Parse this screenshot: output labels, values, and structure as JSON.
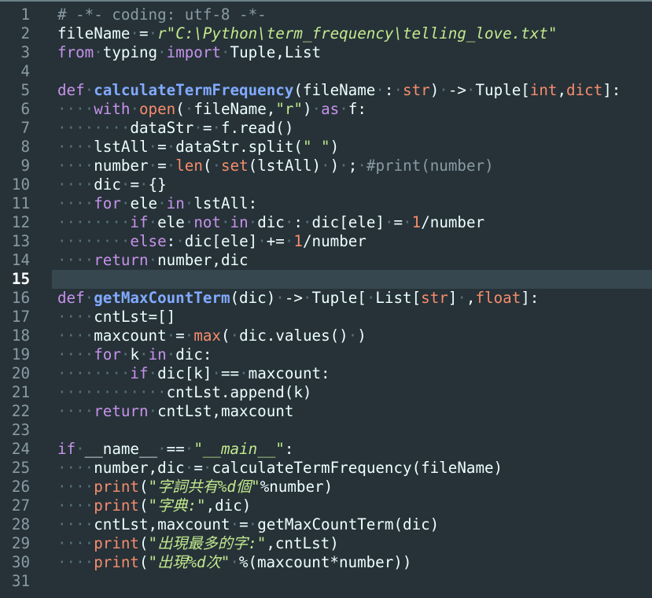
{
  "editor": {
    "language": "python",
    "current_line": 15,
    "line_numbers": [
      "1",
      "2",
      "3",
      "4",
      "5",
      "6",
      "7",
      "8",
      "9",
      "10",
      "11",
      "12",
      "13",
      "14",
      "15",
      "16",
      "17",
      "18",
      "19",
      "20",
      "21",
      "22",
      "23",
      "24",
      "25",
      "26",
      "27",
      "28",
      "29",
      "30",
      "31"
    ],
    "lines": [
      [
        {
          "t": "# -*- coding: utf-8 -*-",
          "c": "cmt"
        }
      ],
      [
        {
          "t": "fileName = "
        },
        {
          "t": "r\"C:\\Python\\term_frequency\\telling_love.txt\"",
          "c": "strit"
        }
      ],
      [
        {
          "t": "from",
          "c": "kw"
        },
        {
          "t": " typing "
        },
        {
          "t": "import",
          "c": "kw"
        },
        {
          "t": " Tuple,List"
        }
      ],
      [],
      [
        {
          "t": "def",
          "c": "kw"
        },
        {
          "t": " "
        },
        {
          "t": "calculateTermFrequency",
          "c": "fn"
        },
        {
          "t": "(fileName : "
        },
        {
          "t": "str",
          "c": "tp"
        },
        {
          "t": ") -> Tuple["
        },
        {
          "t": "int",
          "c": "tp"
        },
        {
          "t": ","
        },
        {
          "t": "dict",
          "c": "tp"
        },
        {
          "t": "]:"
        }
      ],
      [
        {
          "t": "    "
        },
        {
          "t": "with",
          "c": "kw"
        },
        {
          "t": " "
        },
        {
          "t": "open",
          "c": "bi"
        },
        {
          "t": "( fileName,"
        },
        {
          "t": "\"r\"",
          "c": "str"
        },
        {
          "t": ") "
        },
        {
          "t": "as",
          "c": "kw"
        },
        {
          "t": " f:"
        }
      ],
      [
        {
          "t": "        dataStr = f.read()"
        }
      ],
      [
        {
          "t": "    lstAll = dataStr.split("
        },
        {
          "t": "\" \"",
          "c": "str"
        },
        {
          "t": ")"
        }
      ],
      [
        {
          "t": "    number = "
        },
        {
          "t": "len",
          "c": "bi"
        },
        {
          "t": "( "
        },
        {
          "t": "set",
          "c": "bi"
        },
        {
          "t": "(lstAll) ) ; "
        },
        {
          "t": "#print(number)",
          "c": "cmt"
        }
      ],
      [
        {
          "t": "    dic = {}"
        }
      ],
      [
        {
          "t": "    "
        },
        {
          "t": "for",
          "c": "kw"
        },
        {
          "t": " ele "
        },
        {
          "t": "in",
          "c": "kw"
        },
        {
          "t": " lstAll:"
        }
      ],
      [
        {
          "t": "        "
        },
        {
          "t": "if",
          "c": "kw"
        },
        {
          "t": " ele "
        },
        {
          "t": "not in",
          "c": "kw"
        },
        {
          "t": " dic : dic[ele] = "
        },
        {
          "t": "1",
          "c": "num"
        },
        {
          "t": "/number"
        }
      ],
      [
        {
          "t": "        "
        },
        {
          "t": "else",
          "c": "kw"
        },
        {
          "t": ": dic[ele] += "
        },
        {
          "t": "1",
          "c": "num"
        },
        {
          "t": "/number"
        }
      ],
      [
        {
          "t": "    "
        },
        {
          "t": "return",
          "c": "kw"
        },
        {
          "t": " number,dic"
        }
      ],
      [],
      [
        {
          "t": "def",
          "c": "kw"
        },
        {
          "t": " "
        },
        {
          "t": "getMaxCountTerm",
          "c": "fn"
        },
        {
          "t": "(dic) -> Tuple[ List["
        },
        {
          "t": "str",
          "c": "tp"
        },
        {
          "t": "] ,"
        },
        {
          "t": "float",
          "c": "tp"
        },
        {
          "t": "]:"
        }
      ],
      [
        {
          "t": "    cntLst=[]"
        }
      ],
      [
        {
          "t": "    maxcount = "
        },
        {
          "t": "max",
          "c": "bi"
        },
        {
          "t": "( dic.values() )"
        }
      ],
      [
        {
          "t": "    "
        },
        {
          "t": "for",
          "c": "kw"
        },
        {
          "t": " k "
        },
        {
          "t": "in",
          "c": "kw"
        },
        {
          "t": " dic:"
        }
      ],
      [
        {
          "t": "        "
        },
        {
          "t": "if",
          "c": "kw"
        },
        {
          "t": " dic[k] == maxcount:"
        }
      ],
      [
        {
          "t": "            cntLst.append(k)"
        }
      ],
      [
        {
          "t": "    "
        },
        {
          "t": "return",
          "c": "kw"
        },
        {
          "t": " cntLst,maxcount"
        }
      ],
      [],
      [
        {
          "t": "if",
          "c": "kw"
        },
        {
          "t": " __name__ == "
        },
        {
          "t": "\"__main__\"",
          "c": "strit"
        },
        {
          "t": ":"
        }
      ],
      [
        {
          "t": "    number,dic = calculateTermFrequency(fileName)"
        }
      ],
      [
        {
          "t": "    "
        },
        {
          "t": "print",
          "c": "bi"
        },
        {
          "t": "("
        },
        {
          "t": "\"字詞共有%d個\"",
          "c": "strit"
        },
        {
          "t": "%number)"
        }
      ],
      [
        {
          "t": "    "
        },
        {
          "t": "print",
          "c": "bi"
        },
        {
          "t": "("
        },
        {
          "t": "\"字典:\"",
          "c": "strit"
        },
        {
          "t": ",dic)"
        }
      ],
      [
        {
          "t": "    cntLst,maxcount = getMaxCountTerm(dic)"
        }
      ],
      [
        {
          "t": "    "
        },
        {
          "t": "print",
          "c": "bi"
        },
        {
          "t": "("
        },
        {
          "t": "\"出現最多的字:\"",
          "c": "strit"
        },
        {
          "t": ",cntLst)"
        }
      ],
      [
        {
          "t": "    "
        },
        {
          "t": "print",
          "c": "bi"
        },
        {
          "t": "("
        },
        {
          "t": "\"出現%d次\"",
          "c": "strit"
        },
        {
          "t": " %(maxcount*number))"
        }
      ],
      []
    ]
  }
}
